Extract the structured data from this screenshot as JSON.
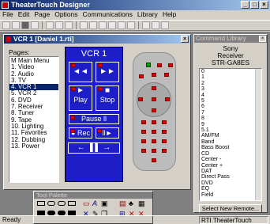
{
  "app": {
    "title": "TheaterTouch Designer",
    "window_buttons": [
      "_",
      "□",
      "×"
    ]
  },
  "menu": [
    "File",
    "Edit",
    "Page",
    "Options",
    "Communications",
    "Library",
    "Help"
  ],
  "vcr_window": {
    "title": "VCR 1 [Daniel 1.rti]",
    "pages_label": "Pages:",
    "pages": [
      "M Main Menu",
      "1. Video",
      "2. Audio",
      "3. TV",
      "4. VCR 1",
      "5. VCR 2",
      "6. DVD",
      "7. Receiver",
      "8. Tuner",
      "9. Tape",
      "10. Lighting",
      "11. Favorites",
      "12. Dubbing",
      "13. Power"
    ],
    "selected_page": "4. VCR 1",
    "remote": {
      "title": "VCR 1",
      "rew_glyph": "◄◄",
      "ff_glyph": "►►",
      "play": "Play",
      "stop": "Stop",
      "play_glyph": "►",
      "stop_glyph": "■",
      "pause": "Pause ll",
      "rec": "Rec",
      "rec_glyph": "●",
      "step_glyph": "ll►",
      "nav_glyph": "←  ▐ ▌  →"
    }
  },
  "library": {
    "title": "Command Library",
    "device": [
      "Sony",
      "Receiver",
      "STR-GA8ES"
    ],
    "commands": [
      "0",
      "1",
      "2",
      "3",
      "4",
      "5",
      "6",
      "7",
      "8",
      "9",
      "5.1",
      "AM/FM",
      "Band",
      "Bass Boost",
      "CD",
      "Center -",
      "Center +",
      "DAT",
      "Direct Pass",
      "DVD",
      "EQ",
      "Field"
    ],
    "button": "Select New Remote..."
  },
  "tool_palette": {
    "title": "Tool Palette"
  },
  "status": {
    "left": "Ready",
    "right": "RTI TheaterTouch"
  },
  "colors": {
    "remote_blue": "#1e1ec8",
    "title_blue": "#0a246a",
    "red_tag": "#e00000"
  }
}
